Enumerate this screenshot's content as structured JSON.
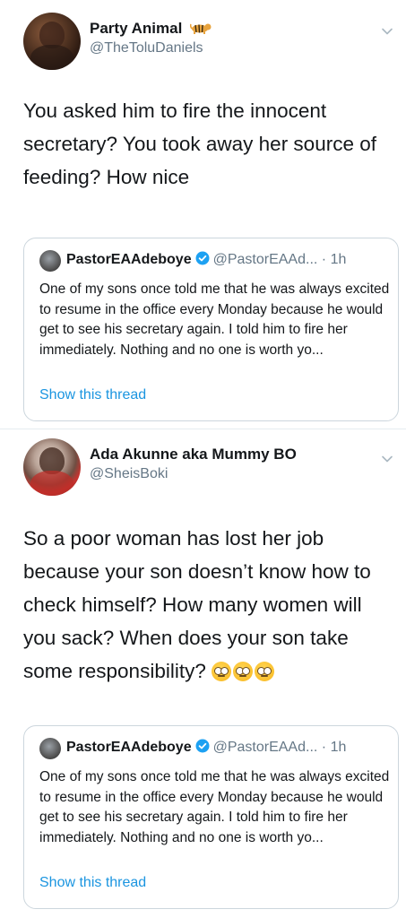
{
  "tweets": [
    {
      "author_name": "Party Animal",
      "author_emoji": "tiger-emoji",
      "author_handle": "@TheToluDaniels",
      "text": "You asked him to fire the innocent secretary? You took away her source of feeding? How nice",
      "quoted": {
        "author_name": "PastorEAAdeboye",
        "verified": true,
        "author_handle": "@PastorEAAd...",
        "separator": "·",
        "time": "1h",
        "text": "One of my sons once told me that he was always excited to resume in the office every Monday because he would get to see his secretary again. I told him to fire her immediately. Nothing and no one is worth yo...",
        "thread_link": "Show this thread"
      }
    },
    {
      "author_name": "Ada Akunne aka Mummy BO",
      "author_handle": "@SheisBoki",
      "text": "So a poor woman has lost her job because your son doesn’t know how to check himself? How many women will you sack? When does your son take some responsibility?",
      "text_emojis": [
        "flushed-face-emoji",
        "flushed-face-emoji",
        "flushed-face-emoji"
      ],
      "quoted": {
        "author_name": "PastorEAAdeboye",
        "verified": true,
        "author_handle": "@PastorEAAd...",
        "separator": "·",
        "time": "1h",
        "text": "One of my sons once told me that he was always excited to resume in the office every Monday because he would get to see his secretary again. I told him to fire her immediately. Nothing and no one is worth yo...",
        "thread_link": "Show this thread"
      }
    }
  ],
  "colors": {
    "text": "#14171a",
    "secondary": "#657786",
    "link": "#1b95e0",
    "border": "#ccd6dd",
    "verified": "#1da1f2"
  }
}
